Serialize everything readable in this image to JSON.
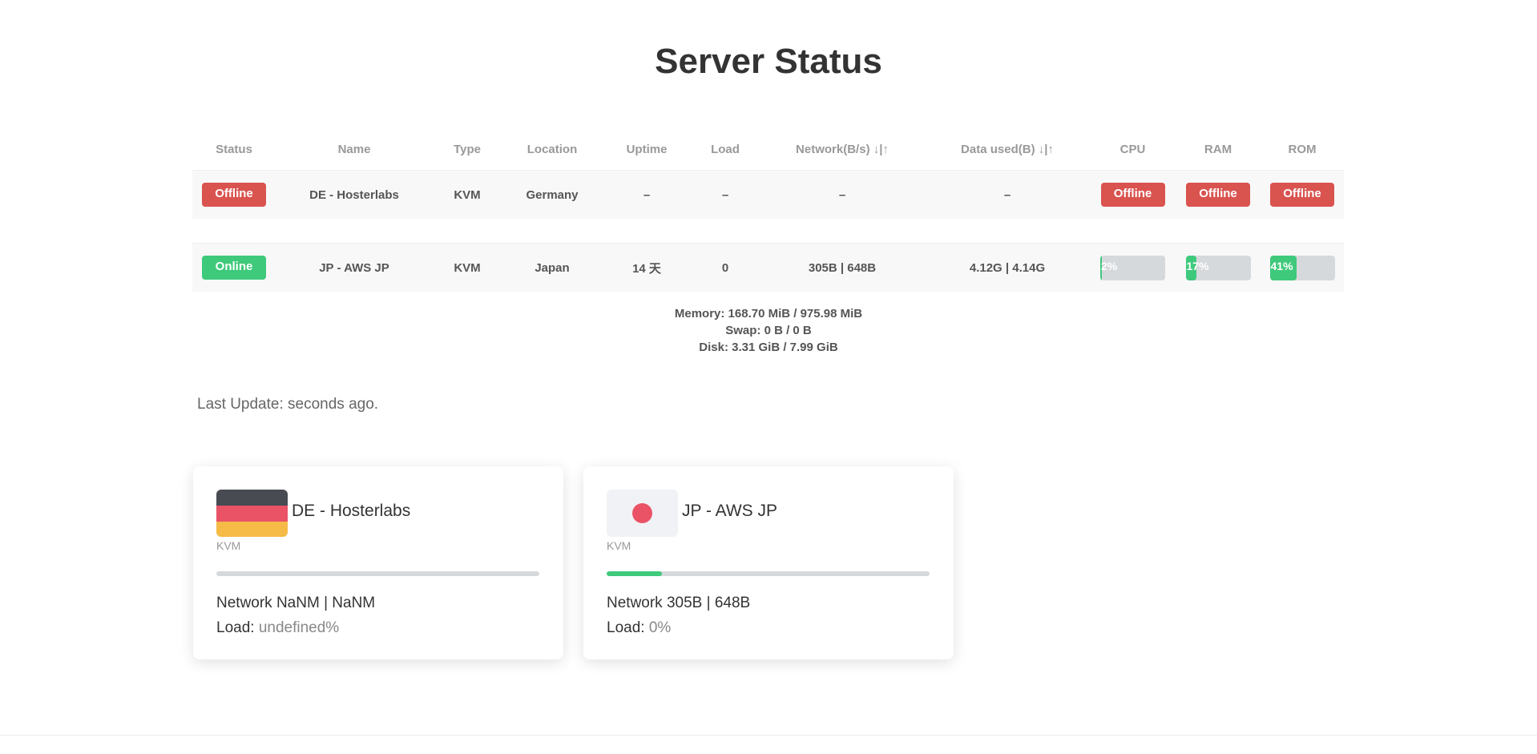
{
  "page": {
    "title": "Server Status"
  },
  "table": {
    "headers": {
      "status": "Status",
      "name": "Name",
      "type": "Type",
      "location": "Location",
      "uptime": "Uptime",
      "load": "Load",
      "network": "Network(B/s) ↓|↑",
      "data_used": "Data used(B) ↓|↑",
      "cpu": "CPU",
      "ram": "RAM",
      "rom": "ROM"
    },
    "rows": [
      {
        "status": "Offline",
        "name": "DE - Hosterlabs",
        "type": "KVM",
        "location": "Germany",
        "uptime": "–",
        "load": "–",
        "network": "–",
        "data_used": "–",
        "cpu": "Offline",
        "ram": "Offline",
        "rom": "Offline"
      },
      {
        "status": "Online",
        "name": "JP - AWS JP",
        "type": "KVM",
        "location": "Japan",
        "uptime": "14 天",
        "load": "0",
        "network": "305B | 648B",
        "data_used": "4.12G | 4.14G",
        "cpu": "2%",
        "cpu_value": 2,
        "ram": "17%",
        "ram_value": 17,
        "rom": "41%",
        "rom_value": 41
      }
    ],
    "details": {
      "memory": "Memory: 168.70 MiB / 975.98 MiB",
      "swap": "Swap: 0 B / 0 B",
      "disk": "Disk: 3.31 GiB / 7.99 GiB"
    }
  },
  "last_update": "Last Update: seconds ago.",
  "cards": [
    {
      "name": "DE - Hosterlabs",
      "type": "KVM",
      "flag": "germany-flag",
      "progress": 0,
      "network": "Network NaNM | NaNM",
      "load_label": "Load: ",
      "load_value": "undefined%"
    },
    {
      "name": "JP - AWS JP",
      "type": "KVM",
      "flag": "japan-flag",
      "progress": 17,
      "network": "Network 305B | 648B",
      "load_label": "Load: ",
      "load_value": "0%"
    }
  ],
  "colors": {
    "offline": "#d9534f",
    "online": "#3ec97b",
    "bar_track": "#d6d9dc"
  }
}
